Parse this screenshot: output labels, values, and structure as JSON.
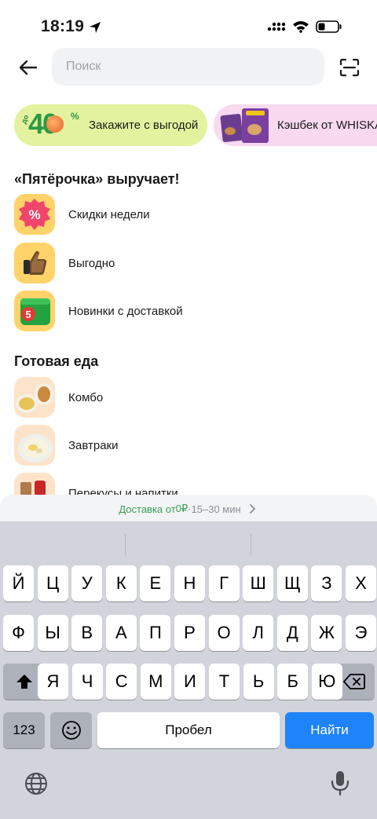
{
  "status_bar": {
    "time": "18:19"
  },
  "search": {
    "placeholder": "Поиск",
    "value": ""
  },
  "promos": [
    {
      "badge_prefix": "до",
      "badge_number": "40",
      "badge_suffix": "%",
      "label": "Закажите с выгодой"
    },
    {
      "label": "Кэшбек от WHISKAS"
    }
  ],
  "sections": [
    {
      "title": "«Пятёрочка» выручает!",
      "items": [
        {
          "label": "Скидки недели",
          "icon": "percent-sticker-icon"
        },
        {
          "label": "Выгодно",
          "icon": "thumbs-up-icon"
        },
        {
          "label": "Новинки с доставкой",
          "icon": "new-delivery-icon"
        }
      ]
    },
    {
      "title": "Готовая еда",
      "items": [
        {
          "label": "Комбо",
          "icon": "combo-food-icon"
        },
        {
          "label": "Завтраки",
          "icon": "breakfast-icon"
        },
        {
          "label": "Перекусы и напитки",
          "icon": "snacks-icon"
        }
      ]
    }
  ],
  "delivery": {
    "prefix": "Доставка от ",
    "price": "0₽",
    "separator": " · ",
    "time": "15–30 мин"
  },
  "keyboard": {
    "row1": [
      "Й",
      "Ц",
      "У",
      "К",
      "Е",
      "Н",
      "Г",
      "Ш",
      "Щ",
      "З",
      "Х"
    ],
    "row2": [
      "Ф",
      "Ы",
      "В",
      "А",
      "П",
      "Р",
      "О",
      "Л",
      "Д",
      "Ж",
      "Э"
    ],
    "row3": [
      "Я",
      "Ч",
      "С",
      "М",
      "И",
      "Т",
      "Ь",
      "Б",
      "Ю"
    ],
    "numbers_label": "123",
    "space_label": "Пробел",
    "action_label": "Найти"
  },
  "colors": {
    "accent_green": "#37a153",
    "key_blue": "#1f84f9",
    "promo_lime": "#e3f29e",
    "promo_pink": "#f8d9f0"
  }
}
